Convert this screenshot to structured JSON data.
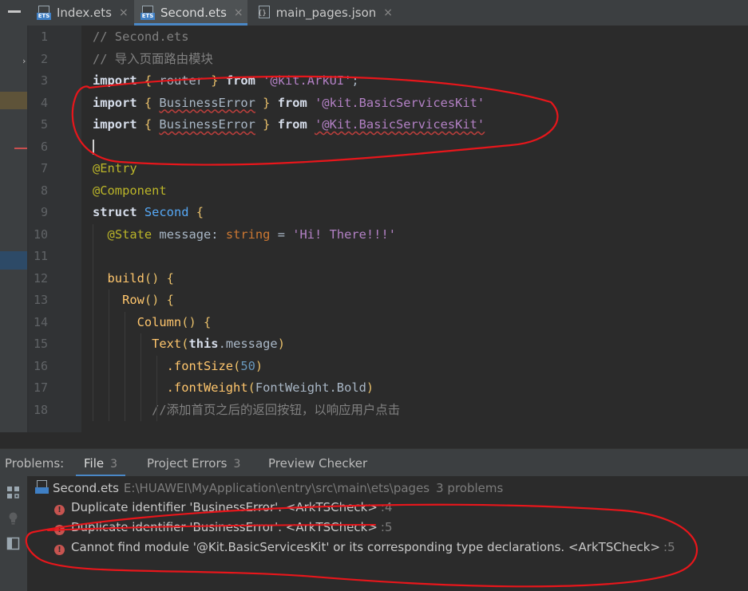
{
  "tabs": [
    {
      "label": "Index.ets",
      "icon": "ets-file-icon",
      "active": false
    },
    {
      "label": "Second.ets",
      "icon": "ets-file-icon",
      "active": true
    },
    {
      "label": "main_pages.json",
      "icon": "json-file-icon",
      "active": false
    }
  ],
  "tab_close_glyph": "×",
  "editor": {
    "line_numbers": [
      "1",
      "2",
      "3",
      "4",
      "5",
      "6",
      "7",
      "8",
      "9",
      "10",
      "11",
      "12",
      "13",
      "14",
      "15",
      "16",
      "17",
      "18"
    ],
    "lines": [
      [
        {
          "t": "// Second.ets",
          "c": "cmt"
        }
      ],
      [
        {
          "t": "// 导入页面路由模块",
          "c": "cmt"
        }
      ],
      [
        {
          "t": "import",
          "c": "kw2"
        },
        {
          "t": " { ",
          "c": "brace"
        },
        {
          "t": "router",
          "c": ""
        },
        {
          "t": " } ",
          "c": "brace"
        },
        {
          "t": "from",
          "c": "kw2"
        },
        {
          "t": " ",
          "c": ""
        },
        {
          "t": "'@kit.ArkUI'",
          "c": "strp"
        },
        {
          "t": ";",
          "c": ""
        }
      ],
      [
        {
          "t": "import",
          "c": "kw2"
        },
        {
          "t": " { ",
          "c": "brace"
        },
        {
          "t": "BusinessError",
          "c": "err"
        },
        {
          "t": " } ",
          "c": "brace"
        },
        {
          "t": "from",
          "c": "kw2"
        },
        {
          "t": " ",
          "c": ""
        },
        {
          "t": "'@kit.BasicServicesKit'",
          "c": "strp"
        }
      ],
      [
        {
          "t": "import",
          "c": "kw2"
        },
        {
          "t": " { ",
          "c": "brace"
        },
        {
          "t": "BusinessError",
          "c": "err"
        },
        {
          "t": " } ",
          "c": "brace"
        },
        {
          "t": "from",
          "c": "kw2"
        },
        {
          "t": " ",
          "c": ""
        },
        {
          "t": "'@Kit.BasicServicesKit'",
          "c": "strp err"
        }
      ],
      [],
      [
        {
          "t": "@Entry",
          "c": "ann"
        }
      ],
      [
        {
          "t": "@Component",
          "c": "ann"
        }
      ],
      [
        {
          "t": "struct",
          "c": "kw2"
        },
        {
          "t": " Second ",
          "c": "cls"
        },
        {
          "t": "{",
          "c": "brace"
        }
      ],
      [
        {
          "t": "  ",
          "c": ""
        },
        {
          "t": "@State",
          "c": "ann"
        },
        {
          "t": " message: ",
          "c": ""
        },
        {
          "t": "string",
          "c": "type"
        },
        {
          "t": " = ",
          "c": ""
        },
        {
          "t": "'Hi! There!!!'",
          "c": "strp"
        }
      ],
      [],
      [
        {
          "t": "  build",
          "c": "fn"
        },
        {
          "t": "() {",
          "c": "brace"
        }
      ],
      [
        {
          "t": "    Row",
          "c": "fn"
        },
        {
          "t": "() {",
          "c": "brace"
        }
      ],
      [
        {
          "t": "      Column",
          "c": "fn"
        },
        {
          "t": "() {",
          "c": "brace"
        }
      ],
      [
        {
          "t": "        Text",
          "c": "fn"
        },
        {
          "t": "(",
          "c": "brace"
        },
        {
          "t": "this",
          "c": "kw2"
        },
        {
          "t": ".message",
          "c": ""
        },
        {
          "t": ")",
          "c": "brace"
        }
      ],
      [
        {
          "t": "          .fontSize",
          "c": "fn"
        },
        {
          "t": "(",
          "c": "brace"
        },
        {
          "t": "50",
          "c": "num"
        },
        {
          "t": ")",
          "c": "brace"
        }
      ],
      [
        {
          "t": "          .fontWeight",
          "c": "fn"
        },
        {
          "t": "(",
          "c": "brace"
        },
        {
          "t": "FontWeight.Bold",
          "c": ""
        },
        {
          "t": ")",
          "c": "brace"
        }
      ],
      [
        {
          "t": "        //添加首页之后的返回按钮，以响应用户点击",
          "c": "cmt"
        }
      ]
    ],
    "caret_line": 6
  },
  "problems": {
    "title": "Problems:",
    "tabs": [
      {
        "label": "File",
        "count": "3",
        "selected": true
      },
      {
        "label": "Project Errors",
        "count": "3",
        "selected": false
      },
      {
        "label": "Preview Checker",
        "count": "",
        "selected": false
      }
    ],
    "file": {
      "name": "Second.ets",
      "path": "E:\\HUAWEI\\MyApplication\\entry\\src\\main\\ets\\pages",
      "count": "3 problems"
    },
    "items": [
      {
        "message": "Duplicate identifier 'BusinessError'. <ArkTSCheck>",
        "location": ":4"
      },
      {
        "message": "Duplicate identifier 'BusinessError'. <ArkTSCheck>",
        "location": ":5"
      },
      {
        "message": "Cannot find module '@Kit.BasicServicesKit' or its corresponding type declarations. <ArkTSCheck>",
        "location": ":5"
      }
    ],
    "error_glyph": "!"
  },
  "colors": {
    "annotation_ink": "#e8161b",
    "accent": "#4a88c7",
    "error": "#c75450"
  }
}
